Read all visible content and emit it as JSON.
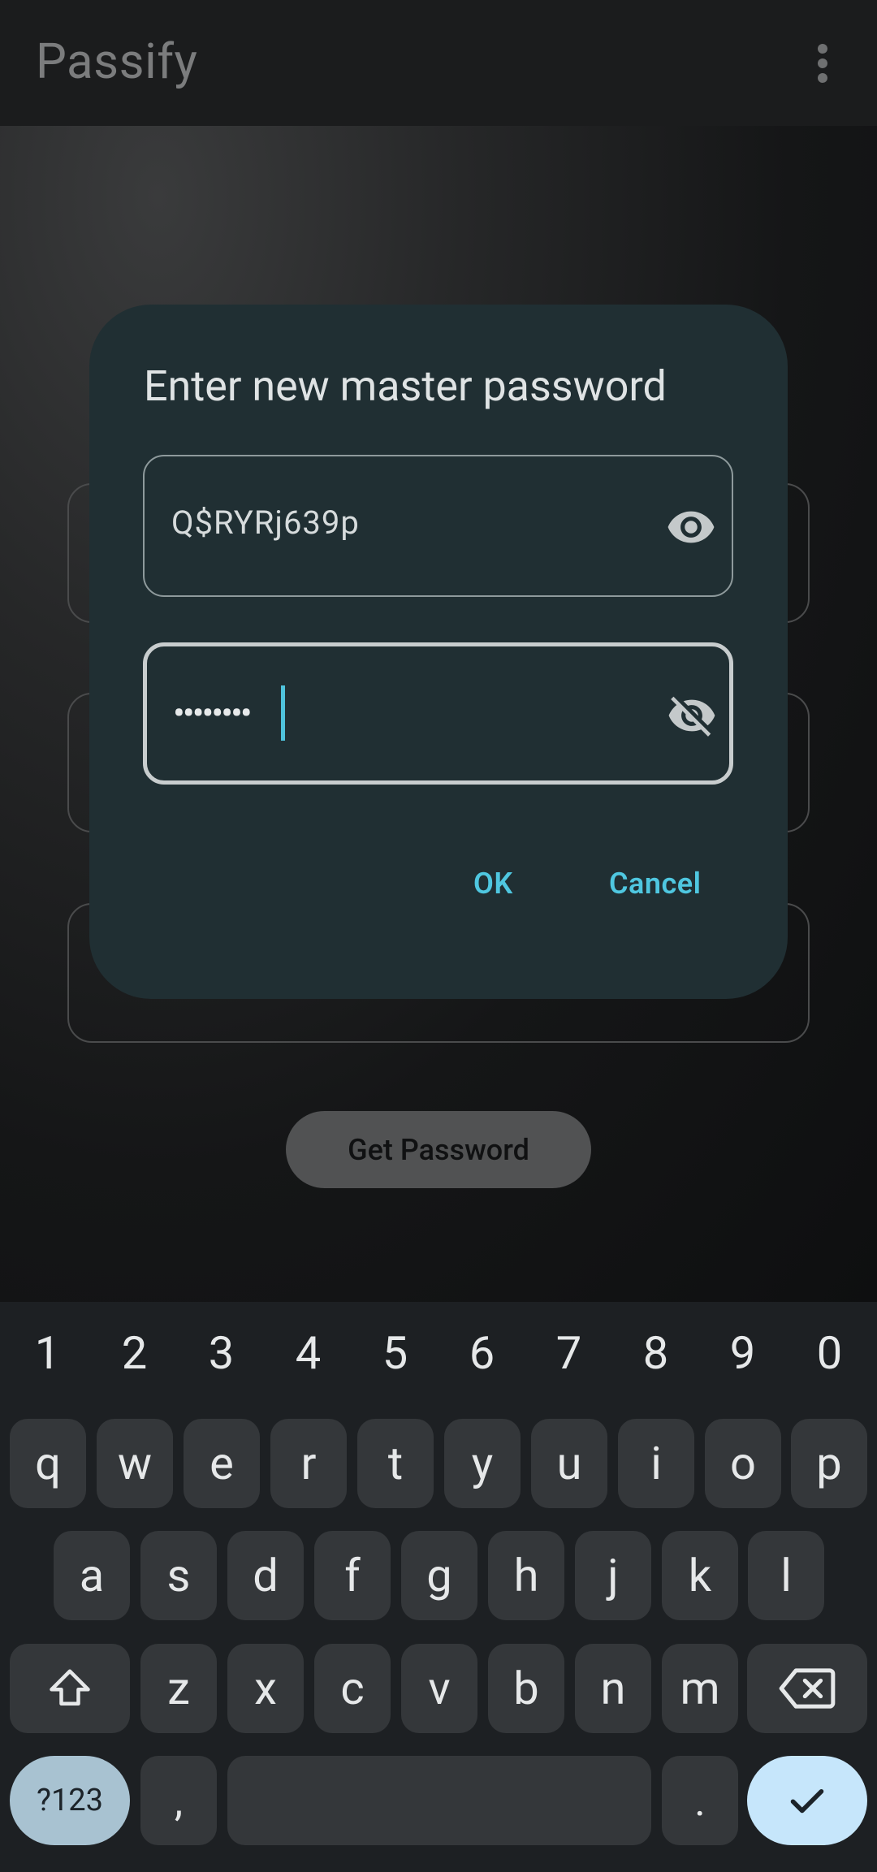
{
  "app": {
    "title": "Passify"
  },
  "background": {
    "get_password_label": "Get Password"
  },
  "dialog": {
    "title": "Enter new master password",
    "field1_value": "Q$RYRj639p",
    "field2_masked": "••••••••",
    "ok_label": "OK",
    "cancel_label": "Cancel"
  },
  "keyboard": {
    "number_row": [
      "1",
      "2",
      "3",
      "4",
      "5",
      "6",
      "7",
      "8",
      "9",
      "0"
    ],
    "row1": [
      "q",
      "w",
      "e",
      "r",
      "t",
      "y",
      "u",
      "i",
      "o",
      "p"
    ],
    "row2": [
      "a",
      "s",
      "d",
      "f",
      "g",
      "h",
      "j",
      "k",
      "l"
    ],
    "row3": [
      "z",
      "x",
      "c",
      "v",
      "b",
      "n",
      "m"
    ],
    "symbols_label": "?123",
    "comma_label": ",",
    "period_label": ".",
    "icons": {
      "shift": "shift-icon",
      "backspace": "backspace-icon",
      "enter": "check-icon"
    }
  },
  "colors": {
    "accent": "#4fc7e0",
    "dialog_bg": "#202f33",
    "enter_key": "#c6e6fb",
    "symbols_key": "#a8c2d1"
  }
}
